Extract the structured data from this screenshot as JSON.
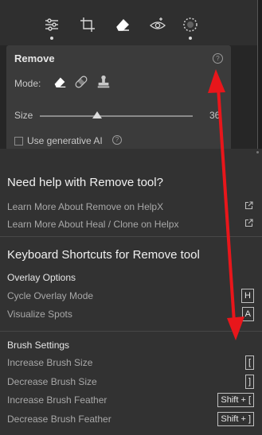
{
  "toolstrip": {
    "icons": [
      "sliders-icon",
      "crop-icon",
      "eraser-icon",
      "redeye-icon",
      "masking-icon"
    ]
  },
  "remove_panel": {
    "title": "Remove",
    "help_glyph": "?",
    "mode_label": "Mode:",
    "modes": [
      "remove",
      "heal",
      "clone"
    ],
    "size_label": "Size",
    "size_value": "36",
    "size_fraction": 0.38,
    "generative_ai_label": "Use generative AI",
    "generative_ai_checked": false,
    "info_glyph": "?"
  },
  "help": {
    "title": "Need help with Remove tool?",
    "links": [
      "Learn More About Remove on HelpX",
      "Learn More About Heal / Clone on Helpx"
    ],
    "shortcuts_title": "Keyboard Shortcuts for Remove tool",
    "overlay_heading": "Overlay Options",
    "overlay_items": [
      {
        "label": "Cycle Overlay Mode",
        "key": "H"
      },
      {
        "label": "Visualize Spots",
        "key": "A"
      }
    ],
    "brush_heading": "Brush Settings",
    "brush_items": [
      {
        "label": "Increase Brush Size",
        "key": "["
      },
      {
        "label": "Decrease Brush Size",
        "key": "]"
      },
      {
        "label": "Increase Brush Feather",
        "key": "Shift + ["
      },
      {
        "label": "Decrease Brush Feather",
        "key": "Shift + ]"
      }
    ]
  },
  "colors": {
    "annotation_arrow": "#e8161b",
    "panel_bg": "#3b3b3b",
    "popover_bg": "#323232"
  }
}
